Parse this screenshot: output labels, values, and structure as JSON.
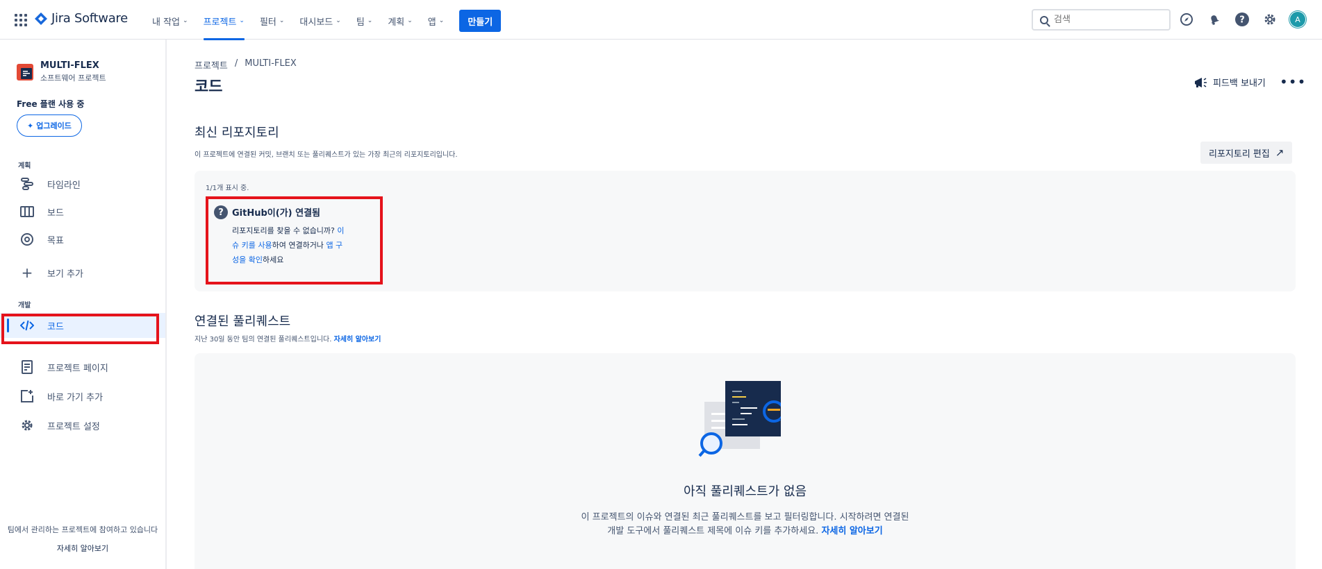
{
  "topnav": {
    "product": "Jira Software",
    "items": [
      {
        "label": "내 작업"
      },
      {
        "label": "프로젝트",
        "active": true
      },
      {
        "label": "필터"
      },
      {
        "label": "대시보드"
      },
      {
        "label": "팀"
      },
      {
        "label": "계획"
      },
      {
        "label": "앱"
      }
    ],
    "create_label": "만들기",
    "search_placeholder": "검색",
    "avatar_initial": "A"
  },
  "sidebar": {
    "project_name": "MULTI-FLEX",
    "project_type": "소프트웨어 프로젝트",
    "plan": "Free 플랜 사용 중",
    "upgrade_label": "업그레이드",
    "section_planning": "계획",
    "section_dev": "개발",
    "items": {
      "timeline": "타임라인",
      "board": "보드",
      "goals": "목표",
      "add_view": "보기 추가",
      "code": "코드",
      "project_pages": "프로젝트 페이지",
      "add_shortcut": "바로 가기 추가",
      "project_settings": "프로젝트 설정"
    },
    "footer_text": "팀에서 관리하는 프로젝트에 참여하고 있습니다",
    "footer_link": "자세히 알아보기"
  },
  "main": {
    "breadcrumb": [
      "프로젝트",
      "/",
      "MULTI-FLEX"
    ],
    "title": "코드",
    "feedback_label": "피드백 보내기",
    "repos": {
      "heading": "최신 리포지토리",
      "description": "이 프로젝트에 연결된 커밋, 브랜치 또는 풀리퀘스트가 있는 가장 최근의 리포지토리입니다.",
      "edit_label": "리포지토리 편집",
      "showing": "1/1개 표시 중.",
      "card_title": "GitHub이(가) 연결됨",
      "card_text_1": "리포지토리를 찾을 수 없습니까? ",
      "card_link_1": "이슈 키를 사용",
      "card_text_2": "하여 연결하거나 ",
      "card_link_2": "앱 구성을 확인",
      "card_text_3": "하세요"
    },
    "pulls": {
      "heading": "연결된 풀리퀘스트",
      "description": "지난 30일 동안 팀의 연결된 풀리퀘스트입니다. ",
      "learn_more": "자세히 알아보기",
      "empty_title": "아직 풀리퀘스트가 없음",
      "empty_desc": "이 프로젝트의 이슈와 연결된 최근 풀리퀘스트를 보고 필터링합니다. 시작하려면 연결된 개발 도구에서 풀리퀘스트 제목에 이슈 키를 추가하세요. ",
      "empty_link": "자세히 알아보기"
    }
  },
  "colors": {
    "accent": "#0c66e4",
    "highlight_box": "#e5131b"
  }
}
